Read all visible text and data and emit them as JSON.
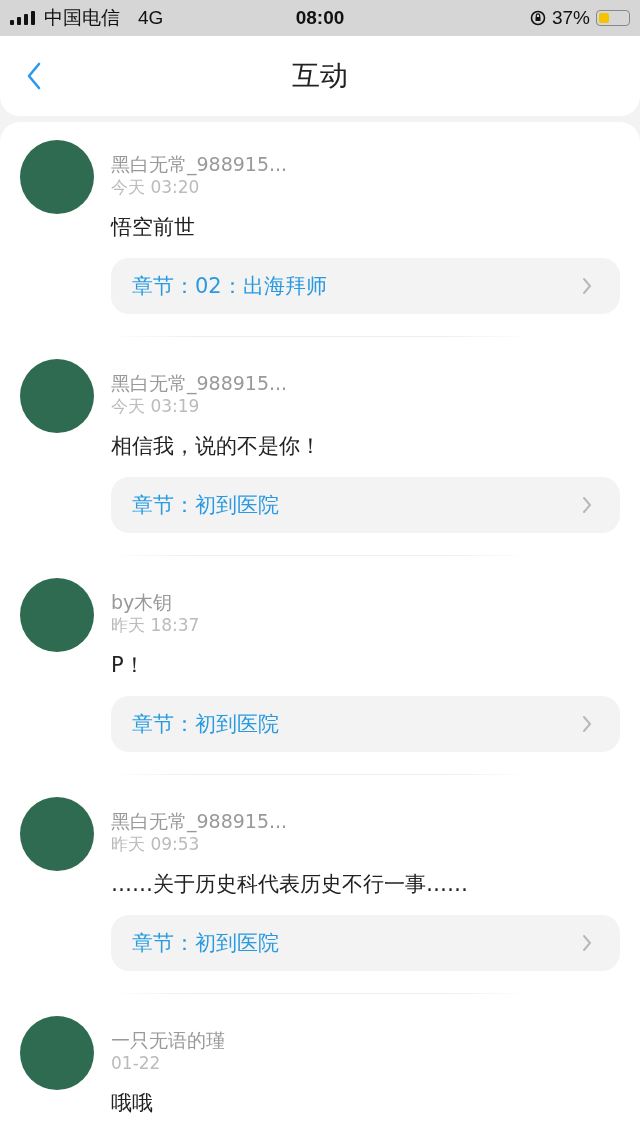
{
  "status_bar": {
    "carrier": "中国电信",
    "network": "4G",
    "time": "08:00",
    "battery": "37%"
  },
  "nav": {
    "title": "互动"
  },
  "comments": [
    {
      "user": "黑白无常_988915...",
      "time": "今天 03:20",
      "text": "悟空前世",
      "chapter": "章节：02：出海拜师"
    },
    {
      "user": "黑白无常_988915...",
      "time": "今天 03:19",
      "text": "相信我，说的不是你！",
      "chapter": "章节：初到医院"
    },
    {
      "user": "by木钥",
      "time": "昨天 18:37",
      "text": "P！",
      "chapter": "章节：初到医院"
    },
    {
      "user": "黑白无常_988915...",
      "time": "昨天 09:53",
      "text": "……关于历史科代表历史不行一事……",
      "chapter": "章节：初到医院"
    },
    {
      "user": "一只无语的瑾",
      "time": "01-22",
      "text": "哦哦"
    }
  ]
}
